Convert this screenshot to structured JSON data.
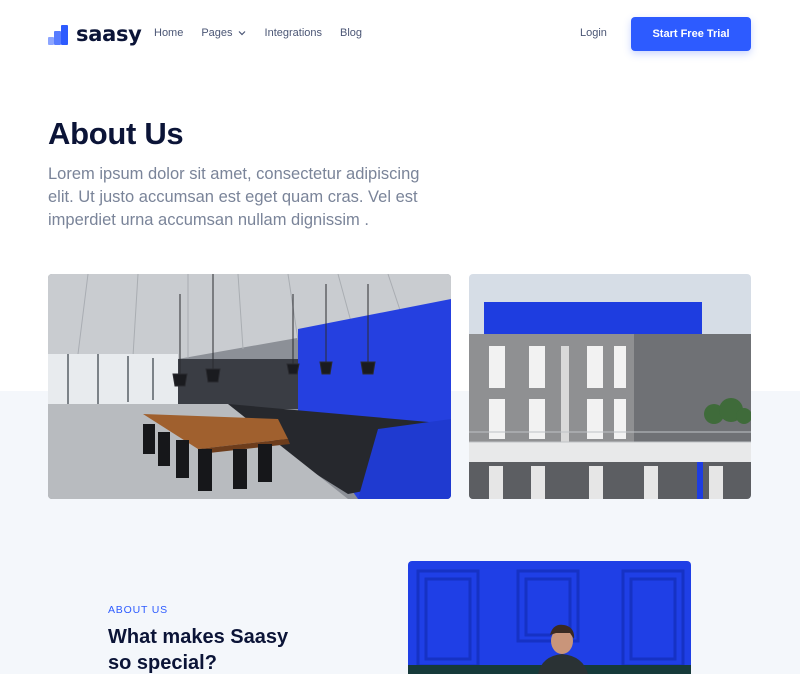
{
  "brand": {
    "name": "saasy",
    "accent": "#2d5bff"
  },
  "nav": {
    "items": [
      {
        "label": "Home"
      },
      {
        "label": "Pages",
        "has_dropdown": true
      },
      {
        "label": "Integrations"
      },
      {
        "label": "Blog"
      }
    ],
    "login_label": "Login",
    "cta_label": "Start Free Trial"
  },
  "hero": {
    "title": "About Us",
    "lead": "Lorem ipsum dolor sit amet, consectetur adipiscing elit. Ut justo accumsan est eget quam cras. Vel est imperdiet urna accumsan nullam dignissim ."
  },
  "images": [
    {
      "name": "office-kitchen-photo"
    },
    {
      "name": "blue-building-photo"
    },
    {
      "name": "person-blue-wall-photo"
    }
  ],
  "about": {
    "eyebrow": "ABOUT US",
    "heading": "What makes Saasy so special?"
  }
}
